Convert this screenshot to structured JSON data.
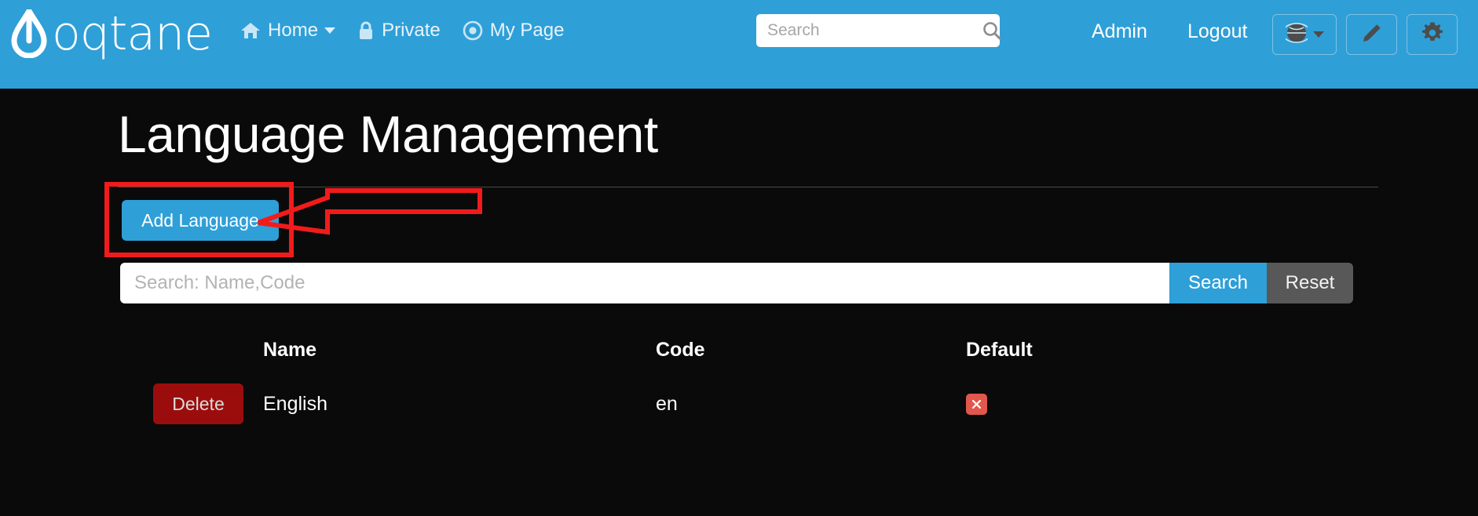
{
  "header": {
    "logo_text": "oqtane",
    "logo_icon": "water-drop-icon",
    "nav": [
      {
        "label": "Home",
        "icon": "home-icon",
        "has_caret": true
      },
      {
        "label": "Private",
        "icon": "lock-icon",
        "has_caret": false
      },
      {
        "label": "My Page",
        "icon": "target-icon",
        "has_caret": false
      }
    ],
    "search": {
      "value": "",
      "placeholder": "Search",
      "icon": "search-icon"
    },
    "admin_label": "Admin",
    "logout_label": "Logout",
    "buttons": [
      {
        "name": "language-selector",
        "icon": "globe-icon",
        "has_caret": true
      },
      {
        "name": "edit-mode",
        "icon": "pencil-icon",
        "has_caret": false
      },
      {
        "name": "site-settings",
        "icon": "gear-icon",
        "has_caret": false
      }
    ],
    "background_color": "#2f9fd8"
  },
  "page": {
    "title": "Language Management",
    "add_button_label": "Add Language",
    "background_color": "#0a0a0a"
  },
  "filter": {
    "input_value": "",
    "input_placeholder": "Search: Name,Code",
    "search_button_label": "Search",
    "reset_button_label": "Reset",
    "search_button_color": "#2f9fd8",
    "reset_button_color": "#585858"
  },
  "table": {
    "columns": [
      "",
      "Name",
      "Code",
      "Default"
    ],
    "rows": [
      {
        "action_label": "Delete",
        "name": "English",
        "code": "en",
        "default": false,
        "default_icon": "x-mark-icon"
      }
    ],
    "delete_button_color": "#9b0d0d",
    "x_badge_color": "#e2574c"
  },
  "annotations": {
    "highlight_color": "#f21b1b",
    "box_target": "add-language-button",
    "arrow_direction": "left"
  }
}
